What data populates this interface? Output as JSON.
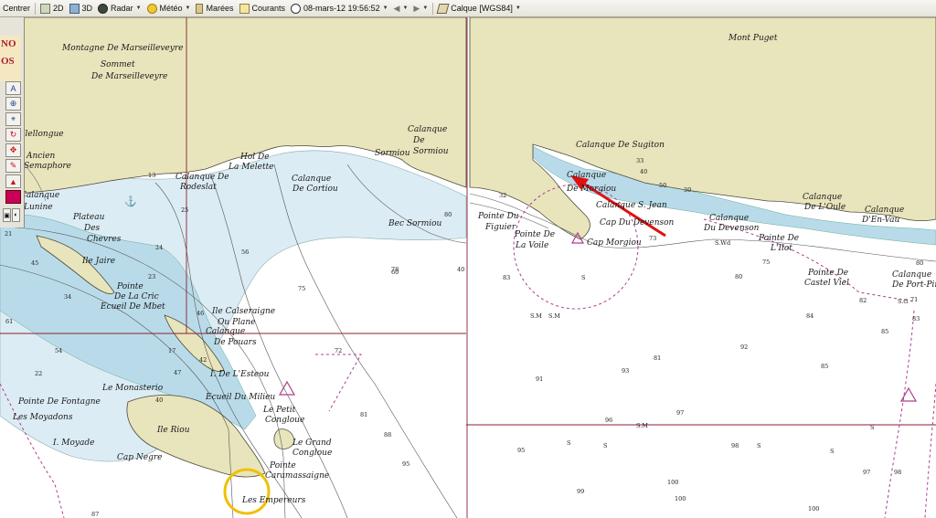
{
  "toolbar": {
    "centrer": "Centrer",
    "view_2d": "2D",
    "view_3d": "3D",
    "radar": "Radar",
    "meteo": "Météo",
    "marees": "Marées",
    "courants": "Courants",
    "datetime": "08-mars-12 19:56:52",
    "calque": "Calque [WGS84]"
  },
  "sidebar": {
    "logo_line1": "NO",
    "logo_line2": "OS"
  },
  "map": {
    "colors": {
      "land": "#e8e4bc",
      "shallow": "#b9dbe9",
      "medium": "#dcecf4",
      "deep": "#ffffff",
      "grid": "#8a2030",
      "coast": "#4a4a3a",
      "route_arrow": "#e01010",
      "highlight_circle": "#f0c000"
    },
    "labels": [
      "Montagne De Marseilleveyre",
      "Sommet",
      "De Marseilleveyre",
      "Mont Puget",
      "Ilellongue",
      "Ancien",
      "Semaphore",
      "Calanque",
      "Lunine",
      "Plateau",
      "Des",
      "Chevres",
      "Calanque De",
      "Rodeslat",
      "Hol De",
      "La Melette",
      "Calanque",
      "De Cortiou",
      "Sormiou",
      "Calanque",
      "De",
      "Sormiou",
      "Bec Sormiou",
      "Calanque De Sugiton",
      "Calanque",
      "De Morgiou",
      "Calanque S. Jean",
      "Cap Du Devenson",
      "Cap Morgiou",
      "Pointe Du",
      "Figuier",
      "Pointe De",
      "La Voile",
      "Calanque",
      "Du Devenson",
      "Calanque",
      "De L'Oule",
      "Calanque",
      "D'En-Vau",
      "Pointe De",
      "L'Ilot",
      "Pointe De",
      "Castel Viel",
      "Calanque",
      "De Port-Pin",
      "Ile Jaire",
      "Pointe",
      "De La Cric",
      "Ecueil De Mbet",
      "Ile Calseraigne",
      "Ou Plane",
      "Calanque",
      "De Pouars",
      "I. De L'Esteou",
      "Ecueil Du Milieu",
      "Le Petit",
      "Congloue",
      "Le Grand",
      "Congloue",
      "Pointe",
      "Caramassaigne",
      "Les Empereurs",
      "Le Monasterio",
      "Pointe De Fontagne",
      "Les Moyadons",
      "Ile Riou",
      "I. Moyade",
      "Cap Negre"
    ],
    "depths": [
      "21",
      "13",
      "25",
      "24",
      "56",
      "78",
      "75",
      "83",
      "45",
      "34",
      "61",
      "54",
      "72",
      "22",
      "47",
      "46",
      "23",
      "42",
      "81",
      "40",
      "60",
      "80",
      "32",
      "50",
      "30",
      "33",
      "40",
      "73",
      "80",
      "75",
      "84",
      "83",
      "85",
      "91",
      "92",
      "93",
      "81",
      "97",
      "95",
      "96",
      "98",
      "100",
      "99",
      "85",
      "82",
      "71",
      "80",
      "40",
      "17",
      "95",
      "88",
      "87",
      "100",
      "98",
      "97",
      "100",
      "S.M",
      "S.M",
      "S",
      "S.Wd",
      "S.M",
      "S.G",
      "S",
      "S",
      "S",
      "S",
      "S"
    ]
  }
}
